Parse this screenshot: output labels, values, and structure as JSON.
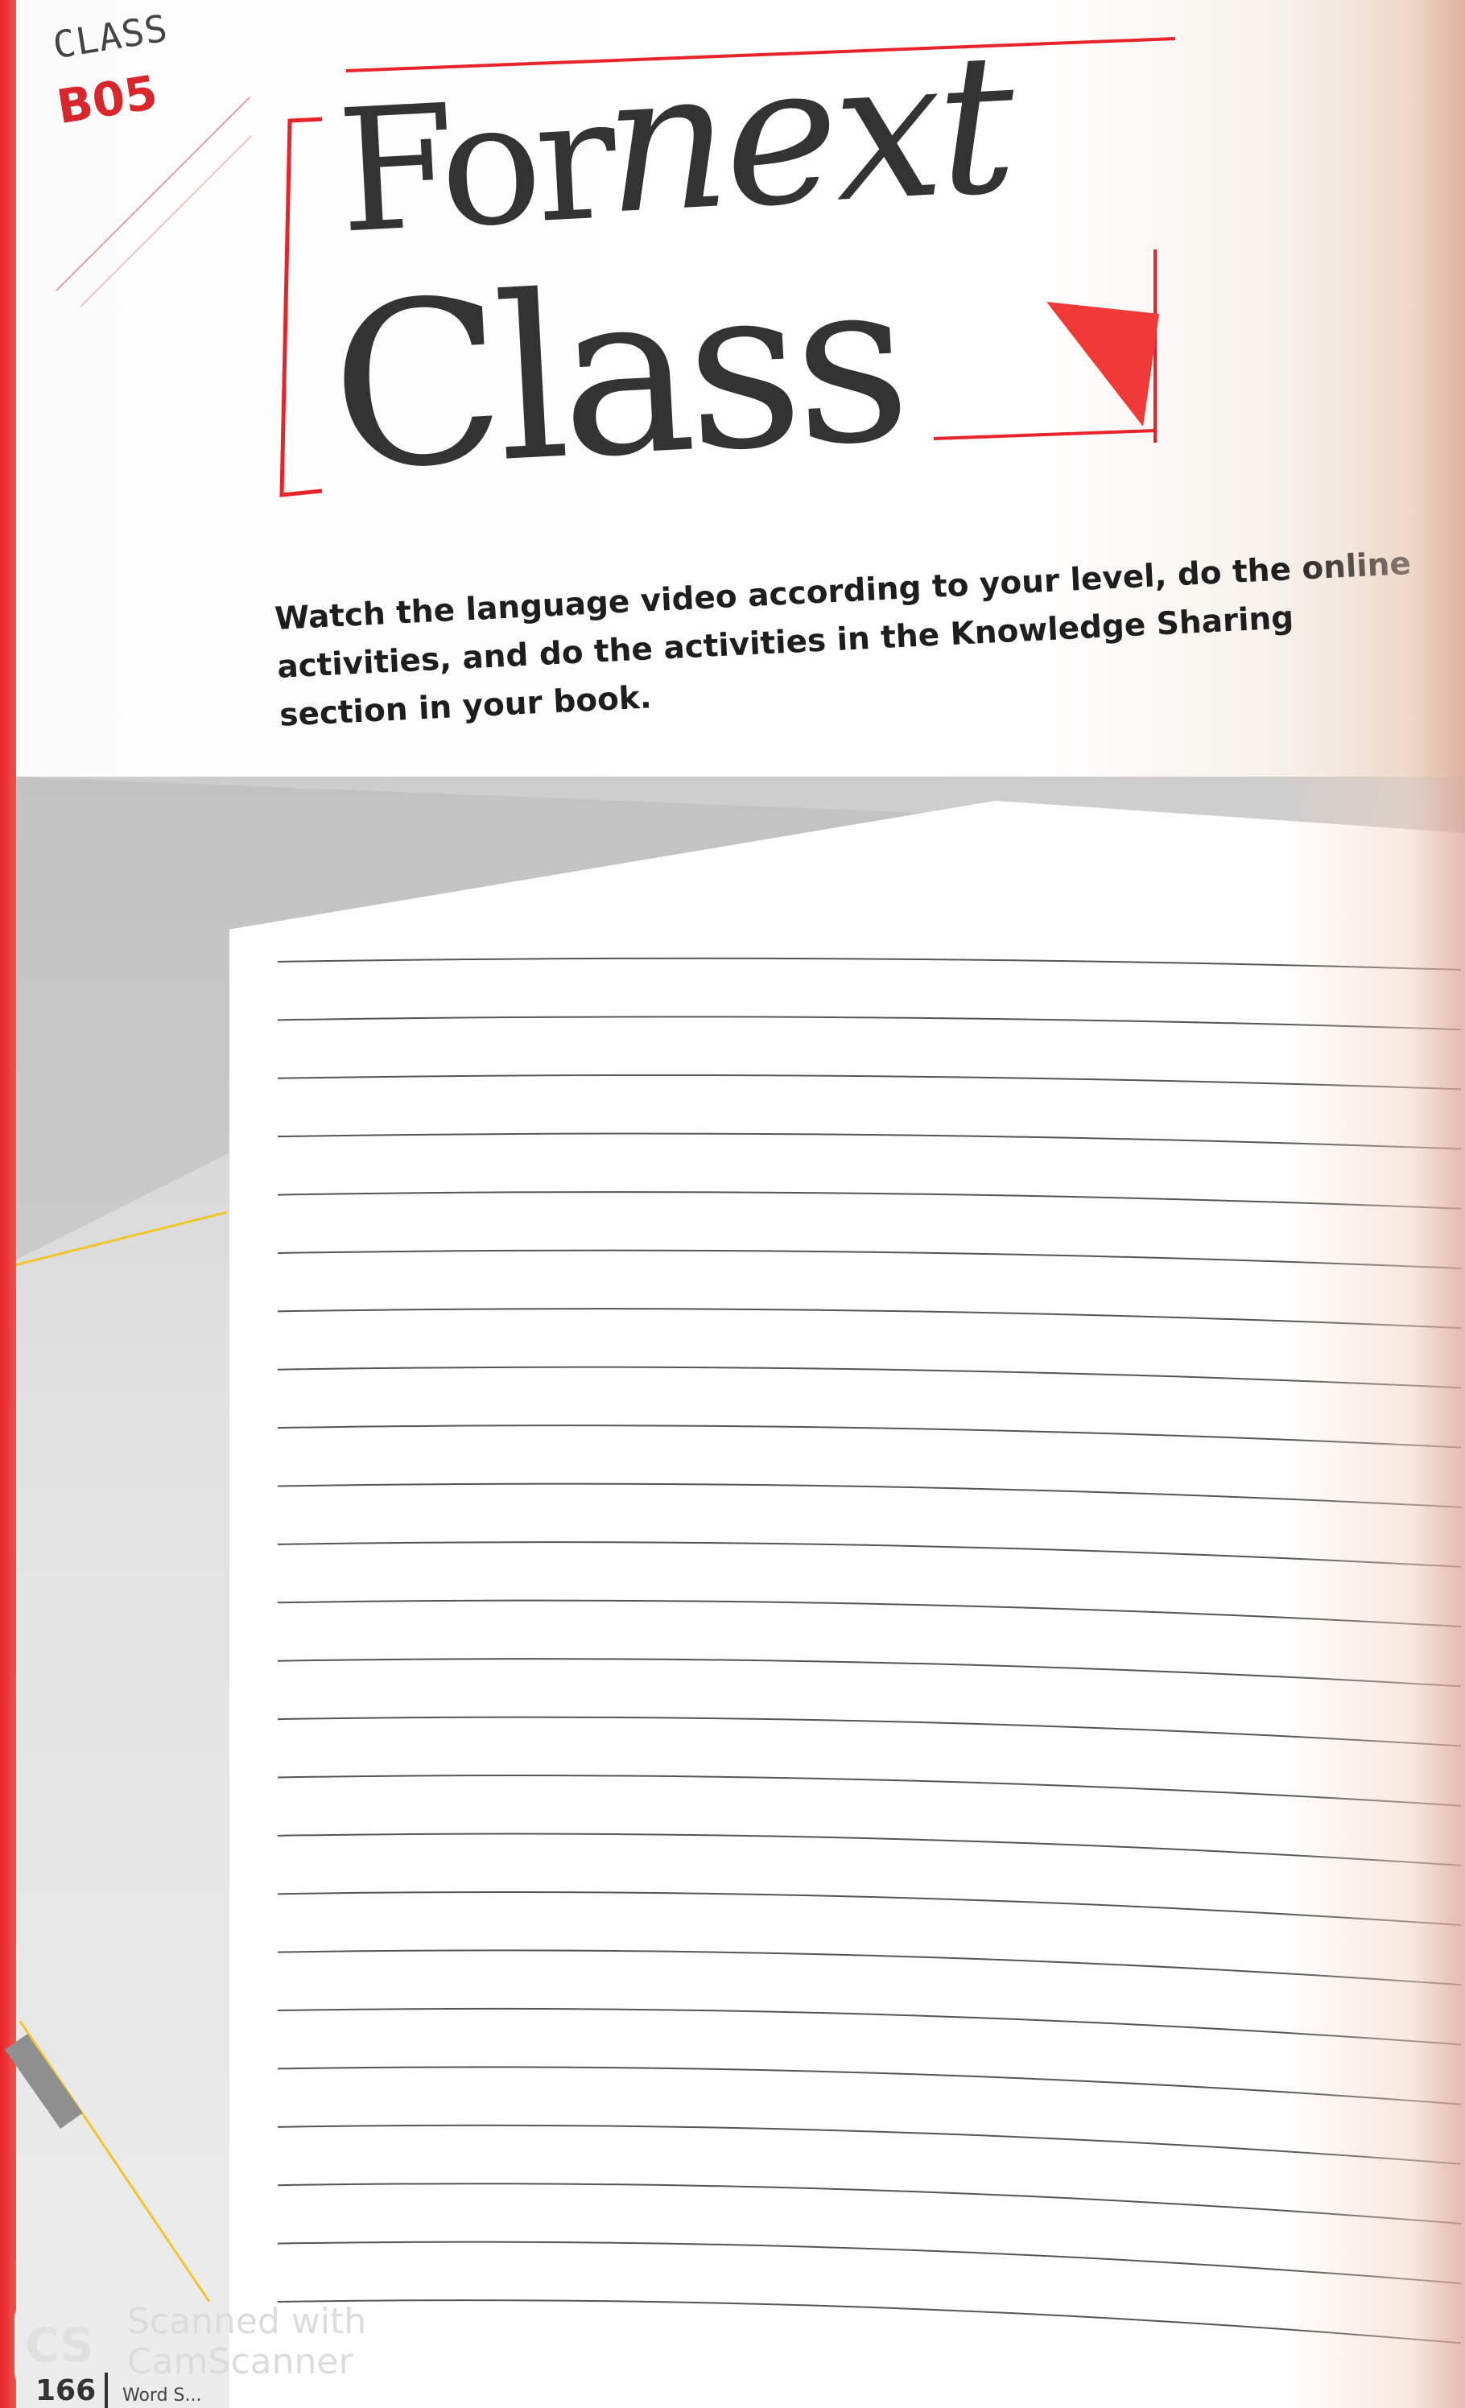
{
  "header": {
    "class_label": "CLASS",
    "class_code": "B05"
  },
  "title": {
    "word1": "For",
    "word2": "next",
    "word3": "Class"
  },
  "instructions": {
    "text": "Watch the language video according to your level, do the online activities, and do the activities in the Knowledge Sharing section in your book."
  },
  "writing_area": {
    "line_count": 24
  },
  "watermark": {
    "logo": "CS",
    "line1": "Scanned with",
    "line2": "CamScanner"
  },
  "footer": {
    "page_number": "166",
    "running_text": "Word S..."
  },
  "colors": {
    "accent_red": "#e8242a",
    "text_dark": "#333333",
    "yellow": "#f2c52a"
  }
}
